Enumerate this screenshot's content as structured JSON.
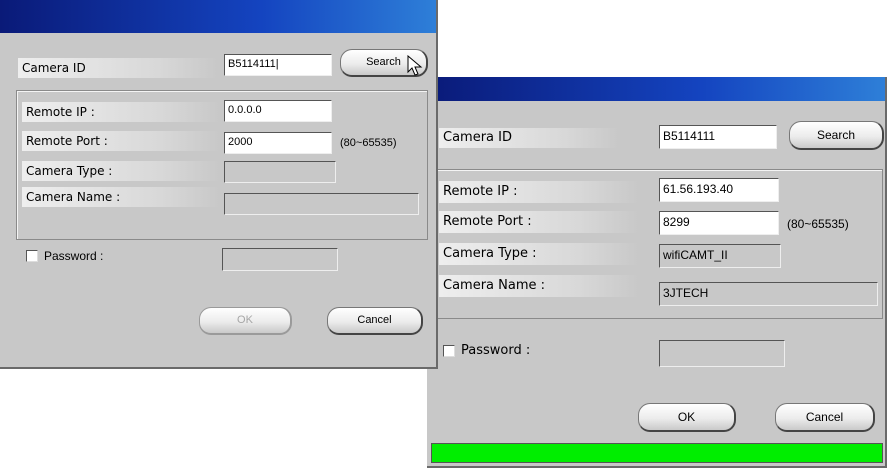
{
  "dialog1": {
    "camera_id_label": "Camera ID",
    "camera_id_value": "B5114111|",
    "search_label": "Search",
    "remote_ip_label": "Remote IP :",
    "remote_ip_value": "0.0.0.0",
    "remote_port_label": "Remote Port :",
    "remote_port_value": "2000",
    "port_range": "(80~65535)",
    "camera_type_label": "Camera Type :",
    "camera_type_value": "",
    "camera_name_label": "Camera Name :",
    "camera_name_value": "",
    "password_label": "Password :",
    "password_value": "",
    "ok_label": "OK",
    "cancel_label": "Cancel"
  },
  "dialog2": {
    "camera_id_label": "Camera ID",
    "camera_id_value": "B5114111",
    "search_label": "Search",
    "remote_ip_label": "Remote IP :",
    "remote_ip_value": "61.56.193.40",
    "remote_port_label": "Remote Port :",
    "remote_port_value": "8299",
    "port_range": "(80~65535)",
    "camera_type_label": "Camera Type :",
    "camera_type_value": "wifiCAMT_II",
    "camera_name_label": "Camera Name :",
    "camera_name_value": "3JTECH",
    "password_label": "Password :",
    "password_value": "",
    "ok_label": "OK",
    "cancel_label": "Cancel",
    "progress_fraction": 1.0,
    "progress_color": "#00ee00"
  },
  "colors": {
    "dialog_bg": "#c8c8c8",
    "title_start": "#0a1a78",
    "title_end": "#2e7fd8"
  },
  "icons": {
    "cursor": "arrow-cursor-icon"
  }
}
